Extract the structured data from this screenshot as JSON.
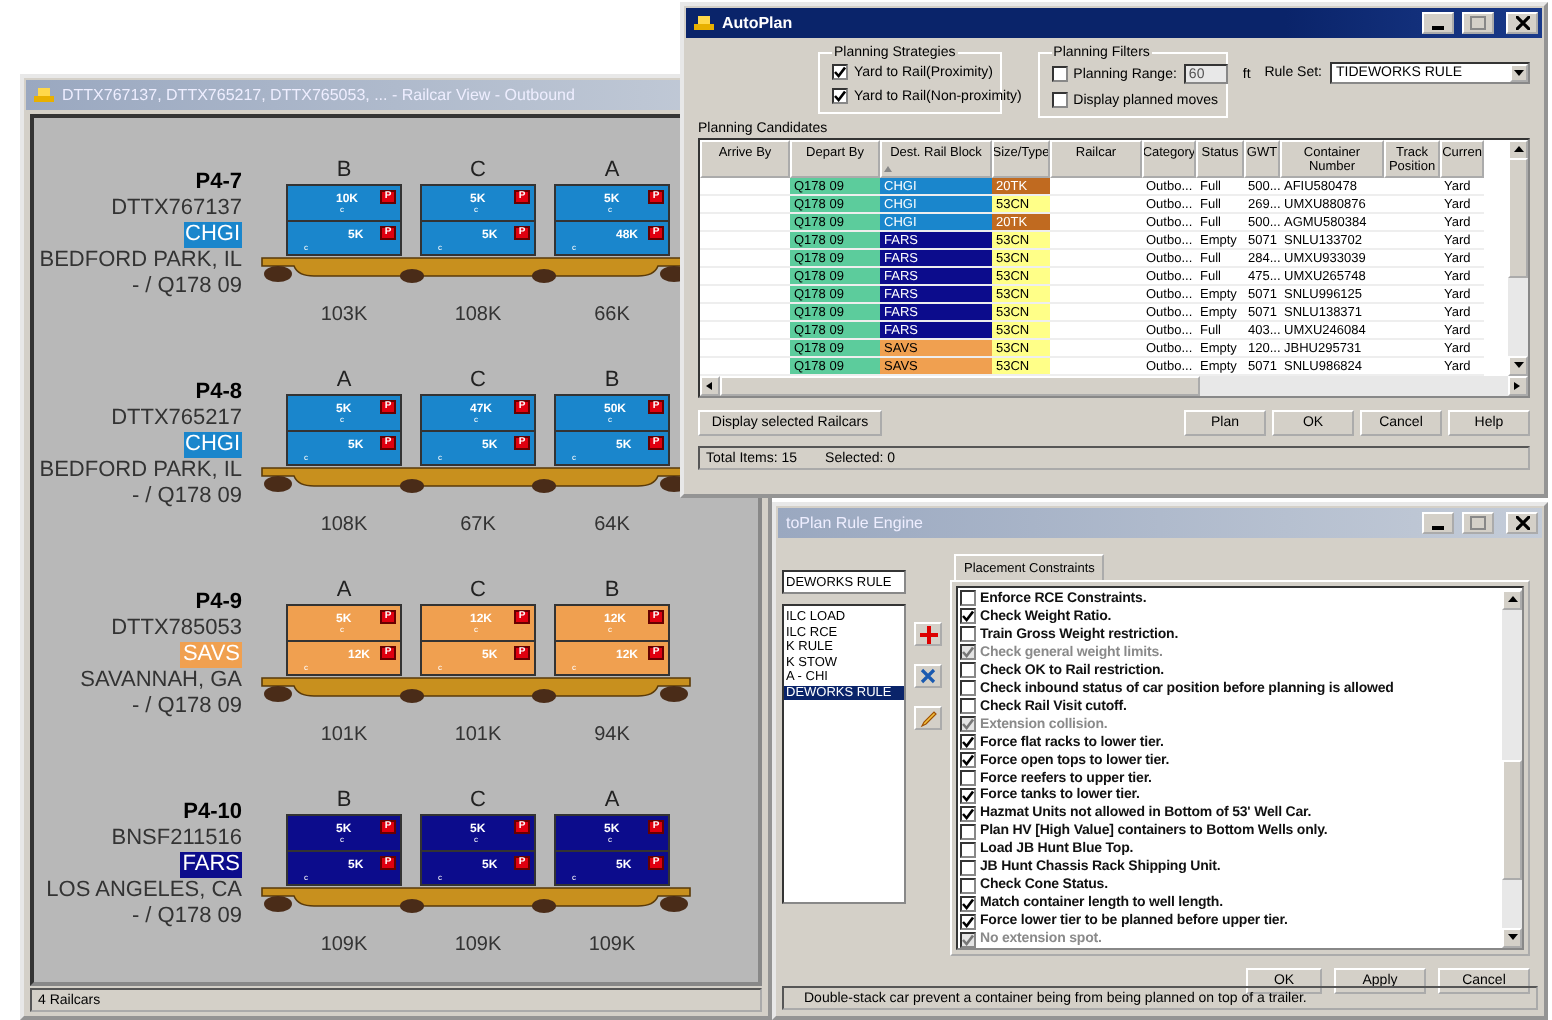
{
  "rule_engine": {
    "title": "toPlan Rule Engine",
    "active": false,
    "rule_name": "DEWORKS RULE",
    "rules": [
      {
        "label": "ILC LOAD",
        "selected": false
      },
      {
        "label": "ILC RCE",
        "selected": false
      },
      {
        "label": "K RULE",
        "selected": false
      },
      {
        "label": "K STOW",
        "selected": false
      },
      {
        "label": "A - CHI",
        "selected": false
      },
      {
        "label": "DEWORKS RULE",
        "selected": true
      }
    ],
    "tabs": [
      {
        "label": "Placement Constraints",
        "selected": true
      }
    ],
    "constraints": [
      {
        "label": "Enforce RCE Constraints.",
        "checked": false,
        "disabled": false
      },
      {
        "label": "Check Weight Ratio.",
        "checked": true,
        "disabled": false
      },
      {
        "label": "Train Gross Weight restriction.",
        "checked": false,
        "disabled": false
      },
      {
        "label": "Check general weight limits.",
        "checked": true,
        "disabled": true
      },
      {
        "label": "Check OK to Rail restriction.",
        "checked": false,
        "disabled": false
      },
      {
        "label": "Check inbound status of car position before planning is allowed",
        "checked": false,
        "disabled": false
      },
      {
        "label": "Check Rail Visit cutoff.",
        "checked": false,
        "disabled": false
      },
      {
        "label": "Extension collision.",
        "checked": true,
        "disabled": true
      },
      {
        "label": "Force flat racks to lower tier.",
        "checked": true,
        "disabled": false
      },
      {
        "label": "Force open tops to lower tier.",
        "checked": true,
        "disabled": false
      },
      {
        "label": "Force reefers to upper tier.",
        "checked": false,
        "disabled": false
      },
      {
        "label": "Force tanks to lower tier.",
        "checked": true,
        "disabled": false
      },
      {
        "label": "Hazmat Units not allowed in Bottom of 53' Well Car.",
        "checked": true,
        "disabled": false
      },
      {
        "label": "Plan HV [High Value] containers to Bottom Wells only.",
        "checked": false,
        "disabled": false
      },
      {
        "label": "Load JB Hunt Blue Top.",
        "checked": false,
        "disabled": false
      },
      {
        "label": "JB Hunt Chassis Rack Shipping Unit.",
        "checked": false,
        "disabled": false
      },
      {
        "label": "Check Cone Status.",
        "checked": false,
        "disabled": false
      },
      {
        "label": "Match container length to well length.",
        "checked": true,
        "disabled": false
      },
      {
        "label": "Force lower tier to be planned before upper tier.",
        "checked": true,
        "disabled": false
      },
      {
        "label": "No extension spot.",
        "checked": true,
        "disabled": true
      }
    ],
    "buttons": [
      "OK",
      "Apply",
      "Cancel"
    ],
    "status": "Double-stack car prevent a container being from being planned on top of a trailer."
  },
  "railcar_view": {
    "title": "DTTX767137, DTTX765217, DTTX765053, ... - Railcar View - Outbound",
    "active": false,
    "railcars": [
      {
        "position": "P4-7",
        "car_id": "DTTX767137",
        "block": "CHGI",
        "color": "#1a86cc",
        "destination": "BEDFORD PARK, IL",
        "train": "- / Q178 09",
        "slots": [
          {
            "letter": "B",
            "weight": "103K",
            "top": {
              "load": "10K",
              "flag": "P",
              "mark": "c"
            },
            "bottom": {
              "load": "5K",
              "flag": "P",
              "mark": "c"
            }
          },
          {
            "letter": "C",
            "weight": "108K",
            "top": {
              "load": "5K",
              "flag": "P",
              "mark": "c"
            },
            "bottom": {
              "load": "5K",
              "flag": "P",
              "mark": "c"
            }
          },
          {
            "letter": "A",
            "weight": "66K",
            "top": {
              "load": "5K",
              "flag": "P",
              "mark": "c"
            },
            "bottom": {
              "load": "48K",
              "flag": "P",
              "mark": "c"
            }
          }
        ]
      },
      {
        "position": "P4-8",
        "car_id": "DTTX765217",
        "block": "CHGI",
        "color": "#1a86cc",
        "destination": "BEDFORD PARK, IL",
        "train": "- / Q178 09",
        "slots": [
          {
            "letter": "A",
            "weight": "108K",
            "top": {
              "load": "5K",
              "flag": "P",
              "mark": "c"
            },
            "bottom": {
              "load": "5K",
              "flag": "P",
              "mark": "c"
            }
          },
          {
            "letter": "C",
            "weight": "67K",
            "top": {
              "load": "47K",
              "flag": "P",
              "mark": "c"
            },
            "bottom": {
              "load": "5K",
              "flag": "P",
              "mark": "c"
            }
          },
          {
            "letter": "B",
            "weight": "64K",
            "top": {
              "load": "50K",
              "flag": "P",
              "mark": "c"
            },
            "bottom": {
              "load": "5K",
              "flag": "P",
              "mark": "c"
            }
          }
        ]
      },
      {
        "position": "P4-9",
        "car_id": "DTTX785053",
        "block": "SAVS",
        "color": "#f0a050",
        "destination": "SAVANNAH, GA",
        "train": "- / Q178 09",
        "slots": [
          {
            "letter": "A",
            "weight": "101K",
            "top": {
              "load": "5K",
              "flag": "P",
              "mark": "c"
            },
            "bottom": {
              "load": "12K",
              "flag": "P",
              "mark": "c"
            }
          },
          {
            "letter": "C",
            "weight": "101K",
            "top": {
              "load": "12K",
              "flag": "P",
              "mark": "c"
            },
            "bottom": {
              "load": "5K",
              "flag": "P",
              "mark": "c"
            }
          },
          {
            "letter": "B",
            "weight": "94K",
            "top": {
              "load": "12K",
              "flag": "P",
              "mark": "c"
            },
            "bottom": {
              "load": "12K",
              "flag": "P",
              "mark": "c"
            }
          }
        ]
      },
      {
        "position": "P4-10",
        "car_id": "BNSF211516",
        "block": "FARS",
        "color": "#0c0c8c",
        "destination": "LOS ANGELES, CA",
        "train": "- / Q178 09",
        "slots": [
          {
            "letter": "B",
            "weight": "109K",
            "top": {
              "load": "5K",
              "flag": "P",
              "mark": "c"
            },
            "bottom": {
              "load": "5K",
              "flag": "P",
              "mark": "c"
            }
          },
          {
            "letter": "C",
            "weight": "109K",
            "top": {
              "load": "5K",
              "flag": "P",
              "mark": "c"
            },
            "bottom": {
              "load": "5K",
              "flag": "P",
              "mark": "c"
            }
          },
          {
            "letter": "A",
            "weight": "109K",
            "top": {
              "load": "5K",
              "flag": "P",
              "mark": "c"
            },
            "bottom": {
              "load": "5K",
              "flag": "P",
              "mark": "c"
            }
          }
        ]
      }
    ],
    "status": "4 Railcars"
  },
  "autoplan": {
    "title": "AutoPlan",
    "active": true,
    "strategies": {
      "label": "Planning Strategies",
      "options": [
        {
          "label": "Yard to Rail(Proximity)",
          "checked": true
        },
        {
          "label": "Yard to Rail(Non-proximity)",
          "checked": true
        }
      ]
    },
    "filters": {
      "label": "Planning Filters",
      "range": {
        "label": "Planning Range:",
        "checked": false,
        "value": "60",
        "unit": "ft"
      },
      "planned": {
        "label": "Display planned moves",
        "checked": false
      }
    },
    "rule_set": {
      "label": "Rule Set:",
      "value": "TIDEWORKS RULE"
    },
    "candidates_label": "Planning Candidates",
    "table": {
      "columns": [
        {
          "label": "Arrive By",
          "sorted": false
        },
        {
          "label": "Depart By",
          "sorted": false
        },
        {
          "label": "Dest. Rail Block",
          "sorted": true
        },
        {
          "label": "Size/Type",
          "sorted": false
        },
        {
          "label": "Railcar",
          "sorted": false
        },
        {
          "label": "Category",
          "sorted": false
        },
        {
          "label": "Status",
          "sorted": false
        },
        {
          "label": "GWT",
          "sorted": false
        },
        {
          "label": "Container Number",
          "sorted": false
        },
        {
          "label": "Track Position",
          "sorted": false
        },
        {
          "label": "Curren",
          "sorted": false
        }
      ],
      "rows": [
        {
          "depart_by": {
            "text": "Q178 09",
            "color": "#5ccc9c"
          },
          "block": {
            "text": "CHGI",
            "color": "#1a86cc"
          },
          "size_type": {
            "text": "20TK",
            "color": "#c06a20"
          },
          "category": "Outbo...",
          "status": "Full",
          "gwt": "500...",
          "container": "AFIU580478",
          "current": "Yard"
        },
        {
          "depart_by": {
            "text": "Q178 09",
            "color": "#5ccc9c"
          },
          "block": {
            "text": "CHGI",
            "color": "#1a86cc"
          },
          "size_type": {
            "text": "53CN",
            "color": "#ffff88"
          },
          "category": "Outbo...",
          "status": "Full",
          "gwt": "269...",
          "container": "UMXU880876",
          "current": "Yard"
        },
        {
          "depart_by": {
            "text": "Q178 09",
            "color": "#5ccc9c"
          },
          "block": {
            "text": "CHGI",
            "color": "#1a86cc"
          },
          "size_type": {
            "text": "20TK",
            "color": "#c06a20"
          },
          "category": "Outbo...",
          "status": "Full",
          "gwt": "500...",
          "container": "AGMU580384",
          "current": "Yard"
        },
        {
          "depart_by": {
            "text": "Q178 09",
            "color": "#5ccc9c"
          },
          "block": {
            "text": "FARS",
            "color": "#0c0c8c"
          },
          "size_type": {
            "text": "53CN",
            "color": "#ffff88"
          },
          "category": "Outbo...",
          "status": "Empty",
          "gwt": "5071",
          "container": "SNLU133702",
          "current": "Yard"
        },
        {
          "depart_by": {
            "text": "Q178 09",
            "color": "#5ccc9c"
          },
          "block": {
            "text": "FARS",
            "color": "#0c0c8c"
          },
          "size_type": {
            "text": "53CN",
            "color": "#ffff88"
          },
          "category": "Outbo...",
          "status": "Full",
          "gwt": "284...",
          "container": "UMXU933039",
          "current": "Yard"
        },
        {
          "depart_by": {
            "text": "Q178 09",
            "color": "#5ccc9c"
          },
          "block": {
            "text": "FARS",
            "color": "#0c0c8c"
          },
          "size_type": {
            "text": "53CN",
            "color": "#ffff88"
          },
          "category": "Outbo...",
          "status": "Full",
          "gwt": "475...",
          "container": "UMXU265748",
          "current": "Yard"
        },
        {
          "depart_by": {
            "text": "Q178 09",
            "color": "#5ccc9c"
          },
          "block": {
            "text": "FARS",
            "color": "#0c0c8c"
          },
          "size_type": {
            "text": "53CN",
            "color": "#ffff88"
          },
          "category": "Outbo...",
          "status": "Empty",
          "gwt": "5071",
          "container": "SNLU996125",
          "current": "Yard"
        },
        {
          "depart_by": {
            "text": "Q178 09",
            "color": "#5ccc9c"
          },
          "block": {
            "text": "FARS",
            "color": "#0c0c8c"
          },
          "size_type": {
            "text": "53CN",
            "color": "#ffff88"
          },
          "category": "Outbo...",
          "status": "Empty",
          "gwt": "5071",
          "container": "SNLU138371",
          "current": "Yard"
        },
        {
          "depart_by": {
            "text": "Q178 09",
            "color": "#5ccc9c"
          },
          "block": {
            "text": "FARS",
            "color": "#0c0c8c"
          },
          "size_type": {
            "text": "53CN",
            "color": "#ffff88"
          },
          "category": "Outbo...",
          "status": "Full",
          "gwt": "403...",
          "container": "UMXU246084",
          "current": "Yard"
        },
        {
          "depart_by": {
            "text": "Q178 09",
            "color": "#5ccc9c"
          },
          "block": {
            "text": "SAVS",
            "color": "#f0a050"
          },
          "size_type": {
            "text": "53CN",
            "color": "#ffff88"
          },
          "category": "Outbo...",
          "status": "Empty",
          "gwt": "120...",
          "container": "JBHU295731",
          "current": "Yard"
        },
        {
          "depart_by": {
            "text": "Q178 09",
            "color": "#5ccc9c"
          },
          "block": {
            "text": "SAVS",
            "color": "#f0a050"
          },
          "size_type": {
            "text": "53CN",
            "color": "#ffff88"
          },
          "category": "Outbo...",
          "status": "Empty",
          "gwt": "5071",
          "container": "SNLU986824",
          "current": "Yard"
        }
      ]
    },
    "left_button": "Display selected Railcars",
    "buttons": [
      "Plan",
      "OK",
      "Cancel",
      "Help"
    ],
    "status": [
      {
        "label": "Total Items: 15"
      },
      {
        "label": "Selected: 0"
      }
    ]
  }
}
